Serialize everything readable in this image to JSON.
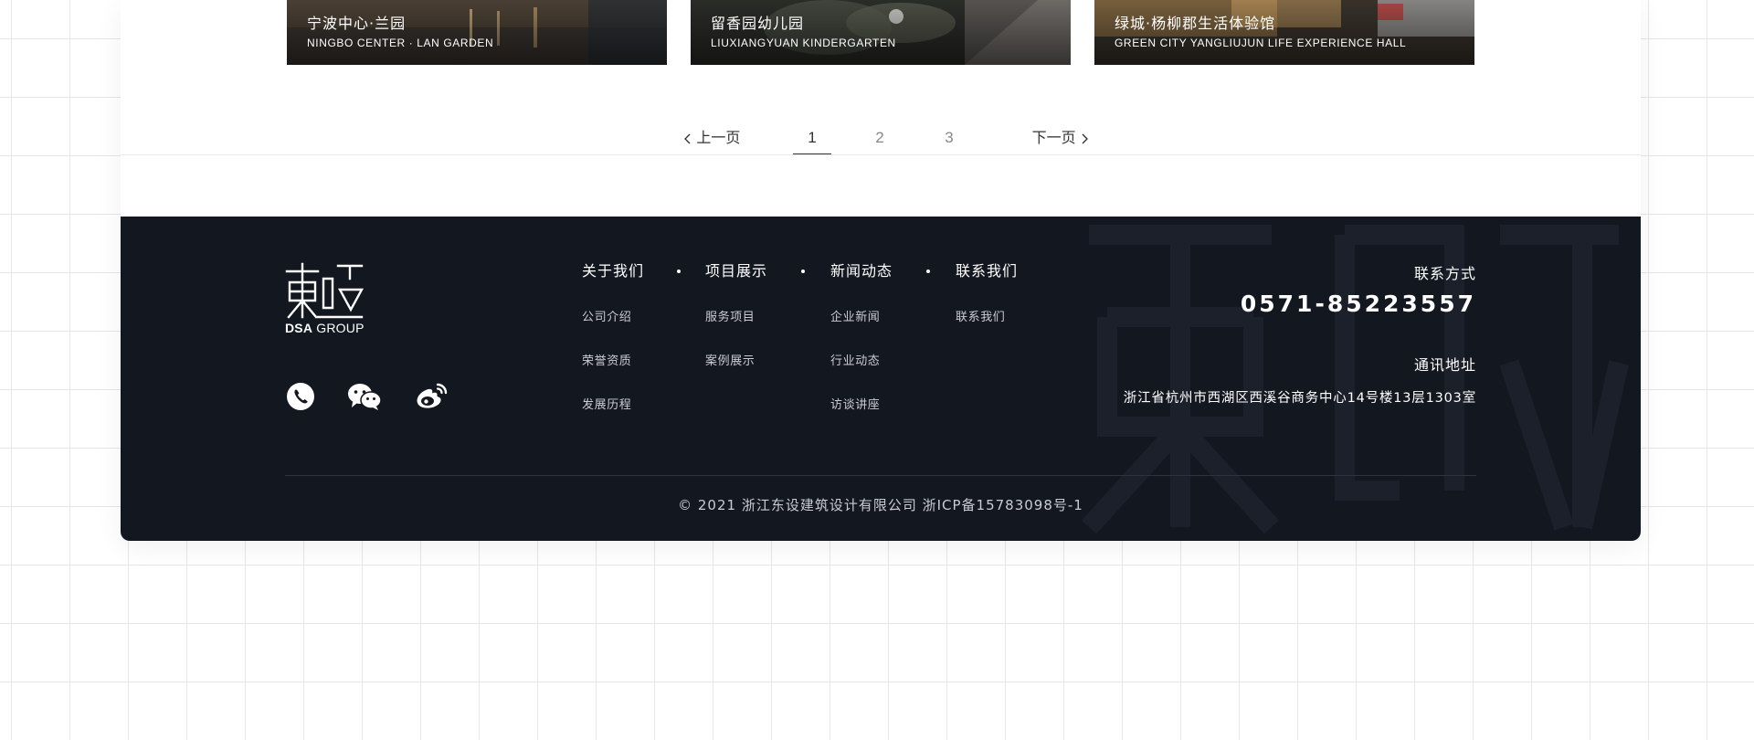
{
  "projects": [
    {
      "title_cn": "宁波中心·兰园",
      "title_en": "NINGBO CENTER · LAN GARDEN"
    },
    {
      "title_cn": "留香园幼儿园",
      "title_en": "LIUXIANGYUAN KINDERGARTEN"
    },
    {
      "title_cn": "绿城·杨柳郡生活体验馆",
      "title_en": "GREEN CITY YANGLIUJUN LIFE EXPERIENCE HALL"
    }
  ],
  "pagination": {
    "prev_label": "上一页",
    "next_label": "下一页",
    "pages": [
      "1",
      "2",
      "3"
    ],
    "current_page": "1"
  },
  "footer": {
    "logo_text_bold": "DSA",
    "logo_text_rest": "GROUP",
    "social_icons": [
      "phone-icon",
      "wechat-icon",
      "weibo-icon"
    ],
    "nav": [
      {
        "title": "关于我们",
        "links": [
          "公司介绍",
          "荣誉资质",
          "发展历程"
        ]
      },
      {
        "title": "项目展示",
        "links": [
          "服务项目",
          "案例展示"
        ]
      },
      {
        "title": "新闻动态",
        "links": [
          "企业新闻",
          "行业动态",
          "访谈讲座"
        ]
      },
      {
        "title": "联系我们",
        "links": [
          "联系我们"
        ]
      }
    ],
    "contact_label": "联系方式",
    "phone": "0571-85223557",
    "address_label": "通讯地址",
    "address": "浙江省杭州市西湖区西溪谷商务中心14号楼13层1303室",
    "copyright": "©  2021  浙江东设建筑设计有限公司  浙ICP备15783098号-1"
  },
  "colors": {
    "footer_bg": "#131720",
    "accent": "#ffffff",
    "text_muted": "#c9ccd2"
  }
}
